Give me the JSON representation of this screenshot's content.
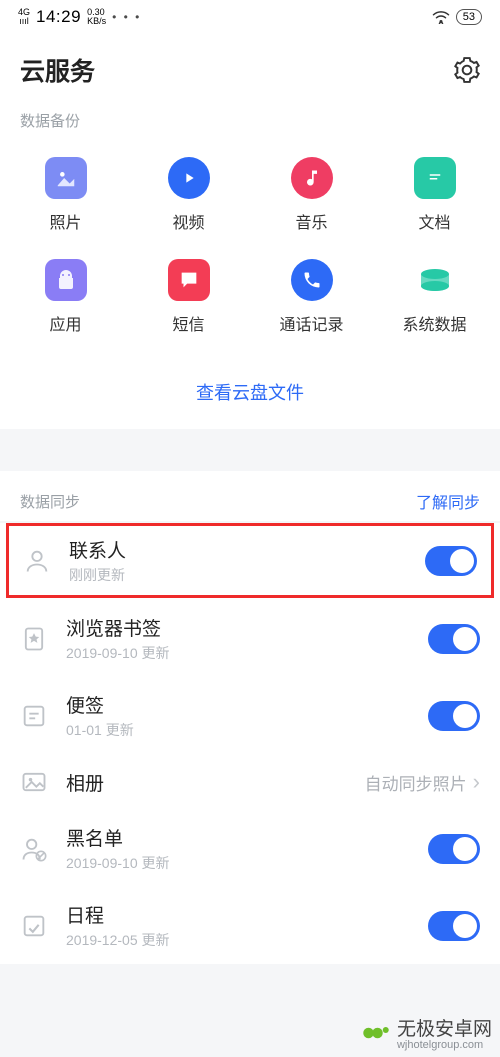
{
  "status": {
    "net": "4G",
    "signal": "ıııl",
    "time": "14:29",
    "kbs": "0.30\nKB/s",
    "dots": "• • •",
    "battery": "53"
  },
  "header": {
    "title": "云服务"
  },
  "backup": {
    "label": "数据备份",
    "items": [
      {
        "label": "照片",
        "icon": "photo"
      },
      {
        "label": "视频",
        "icon": "video"
      },
      {
        "label": "音乐",
        "icon": "music"
      },
      {
        "label": "文档",
        "icon": "doc"
      },
      {
        "label": "应用",
        "icon": "app"
      },
      {
        "label": "短信",
        "icon": "sms"
      },
      {
        "label": "通话记录",
        "icon": "call"
      },
      {
        "label": "系统数据",
        "icon": "system"
      }
    ],
    "disk_link": "查看云盘文件"
  },
  "sync": {
    "label": "数据同步",
    "learn": "了解同步",
    "rows": [
      {
        "key": "contacts",
        "title": "联系人",
        "sub": "刚刚更新",
        "toggle": true,
        "highlighted": true
      },
      {
        "key": "bookmarks",
        "title": "浏览器书签",
        "sub": "2019-09-10 更新",
        "toggle": true
      },
      {
        "key": "notes",
        "title": "便签",
        "sub": "01-01 更新",
        "toggle": true
      },
      {
        "key": "album",
        "title": "相册",
        "value": "自动同步照片",
        "chevron": true
      },
      {
        "key": "blacklist",
        "title": "黑名单",
        "sub": "2019-09-10 更新",
        "toggle": true
      },
      {
        "key": "schedule",
        "title": "日程",
        "sub": "2019-12-05 更新",
        "toggle": true
      }
    ]
  },
  "watermark": {
    "brand": "无极安卓网",
    "url": "wjhotelgroup.com"
  }
}
